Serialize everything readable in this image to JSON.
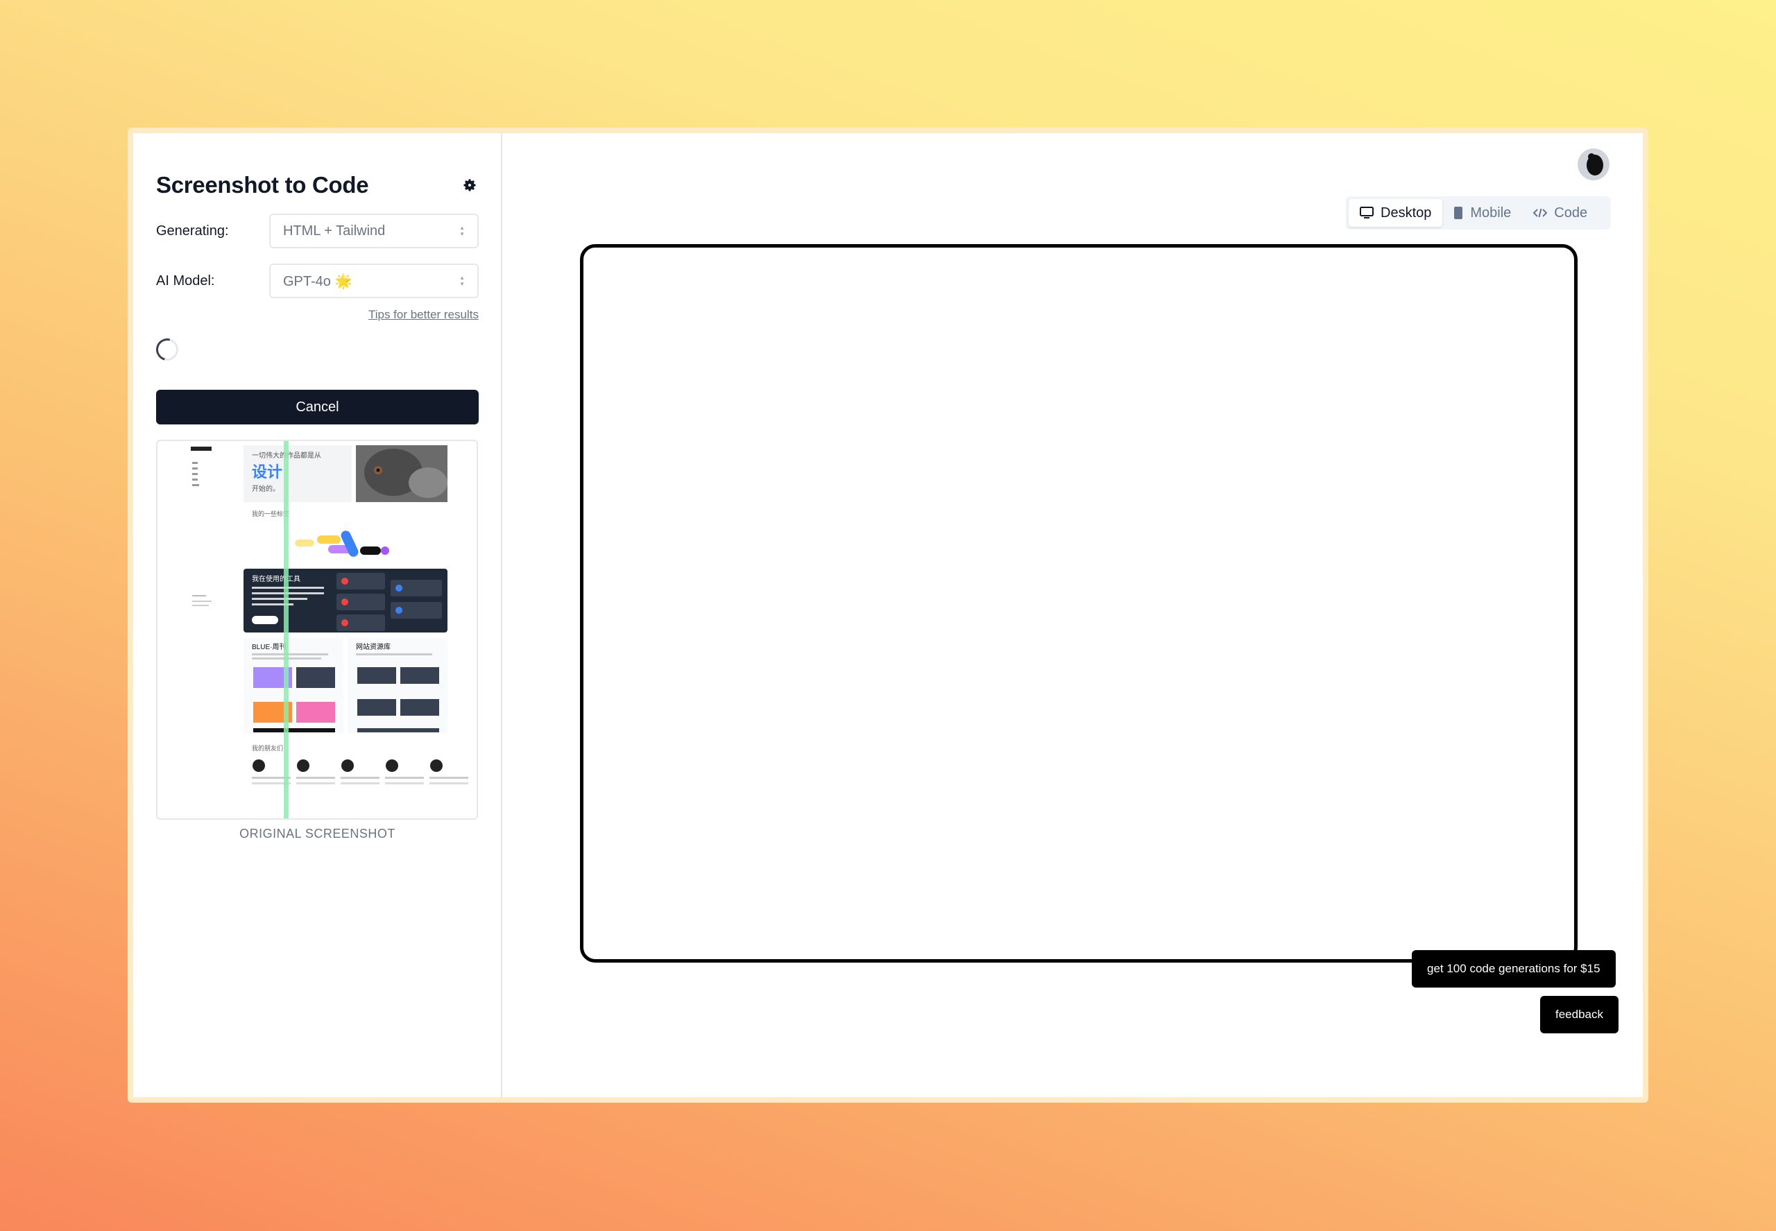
{
  "app": {
    "title": "Screenshot to Code"
  },
  "settings": {
    "generating_label": "Generating:",
    "generating_value": "HTML + Tailwind",
    "model_label": "AI Model:",
    "model_value": "GPT-4o 🌟",
    "tips_link": "Tips for better results"
  },
  "actions": {
    "cancel_label": "Cancel"
  },
  "screenshot": {
    "caption": "ORIGINAL SCREENSHOT",
    "hero_text_1": "一切伟大的作品都是从",
    "hero_highlight": "设计",
    "hero_text_2": "开始的。",
    "section_works": "我的一些标签",
    "tools_title": "我在使用的工具",
    "tools_desc": "这些工具极大提升了我的效率且喜欢我的工作流生态，希望它们也能帮到你。",
    "tools_button": "查看更多",
    "card1_title": "BLUE·周刊",
    "card2_title": "网站资源库",
    "friends_title": "我的朋友们"
  },
  "viewer": {
    "tabs": [
      {
        "label": "Desktop",
        "icon": "monitor-icon",
        "active": true
      },
      {
        "label": "Mobile",
        "icon": "phone-icon",
        "active": false
      },
      {
        "label": "Code",
        "icon": "code-icon",
        "active": false
      }
    ]
  },
  "promo": {
    "label": "get 100 code generations for $15"
  },
  "feedback": {
    "label": "feedback"
  },
  "colors": {
    "accent": "#111827",
    "highlight": "#3b82f6",
    "scan_line": "#86efac"
  }
}
